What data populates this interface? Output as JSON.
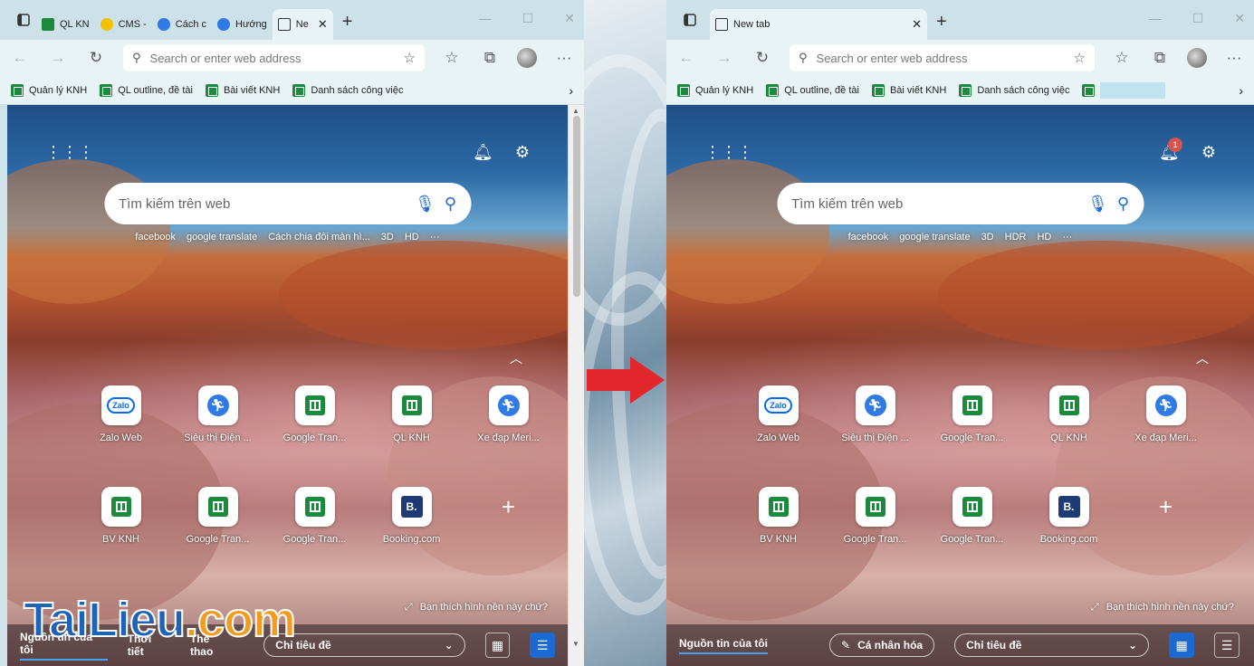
{
  "left_window": {
    "tabs": [
      {
        "label": "QL KN",
        "icon": "sheet-icon",
        "active": false
      },
      {
        "label": "CMS -",
        "icon": "cms-icon",
        "active": false
      },
      {
        "label": "Cách c",
        "icon": "runner-icon",
        "active": false
      },
      {
        "label": "Hướng",
        "icon": "runner-icon",
        "active": false
      },
      {
        "label": "Ne",
        "icon": "newtab-icon",
        "active": true
      }
    ],
    "address_placeholder": "Search or enter web address",
    "bookmarks": [
      "Quản lý KNH",
      "QL outline, đề tài",
      "Bài viết KNH",
      "Danh sách công việc"
    ],
    "search_placeholder": "Tìm kiếm trên web",
    "quick_links": [
      "facebook",
      "google translate",
      "Cách chia đôi màn hì...",
      "3D",
      "HD",
      "···"
    ],
    "tiles": [
      {
        "label": "Zalo Web",
        "type": "zalo"
      },
      {
        "label": "Siêu thị Điện ...",
        "type": "runner"
      },
      {
        "label": "Google Tran...",
        "type": "sheet"
      },
      {
        "label": "QL KNH",
        "type": "sheet"
      },
      {
        "label": "Xe đạp Meri...",
        "type": "runner"
      },
      {
        "label": "BV KNH",
        "type": "sheet"
      },
      {
        "label": "Google Tran...",
        "type": "sheet"
      },
      {
        "label": "Google Tran...",
        "type": "sheet"
      },
      {
        "label": "Booking.com",
        "type": "booking"
      },
      {
        "label": "",
        "type": "add"
      }
    ],
    "wallpaper_question": "Bạn thích hình nền này chứ?",
    "feed": [
      "Nguồn tin của tôi",
      "Thời tiết",
      "Thể thao"
    ],
    "feed_select": "Chỉ tiêu đề"
  },
  "right_window": {
    "tab_label": "New tab",
    "address_placeholder": "Search or enter web address",
    "bookmarks": [
      "Quản lý KNH",
      "QL outline, đề tài",
      "Bài viết KNH",
      "Danh sách công việc"
    ],
    "notification_count": "1",
    "search_placeholder": "Tìm kiếm trên web",
    "quick_links": [
      "facebook",
      "google translate",
      "3D",
      "HDR",
      "HD",
      "···"
    ],
    "tiles": [
      {
        "label": "Zalo Web",
        "type": "zalo"
      },
      {
        "label": "Siêu thị Điện ...",
        "type": "runner"
      },
      {
        "label": "Google Tran...",
        "type": "sheet"
      },
      {
        "label": "QL KNH",
        "type": "sheet"
      },
      {
        "label": "Xe đạp Meri...",
        "type": "runner"
      },
      {
        "label": "BV KNH",
        "type": "sheet"
      },
      {
        "label": "Google Tran...",
        "type": "sheet"
      },
      {
        "label": "Google Tran...",
        "type": "sheet"
      },
      {
        "label": "Booking.com",
        "type": "booking"
      },
      {
        "label": "",
        "type": "add"
      }
    ],
    "wallpaper_question": "Bạn thích hình nền này chứ?",
    "feed_active": "Nguồn tin của tôi",
    "personalize": "Cá nhân hóa",
    "feed_select": "Chỉ tiêu đề"
  },
  "icons": {
    "zalo_text": "Zalo",
    "booking_text": "B."
  },
  "watermark": {
    "part1": "TaiLieu",
    "part2": ".com"
  },
  "colors": {
    "arrow": "#e3262c",
    "accent": "#1a6ad1",
    "sheet_green": "#1b8a3d"
  }
}
